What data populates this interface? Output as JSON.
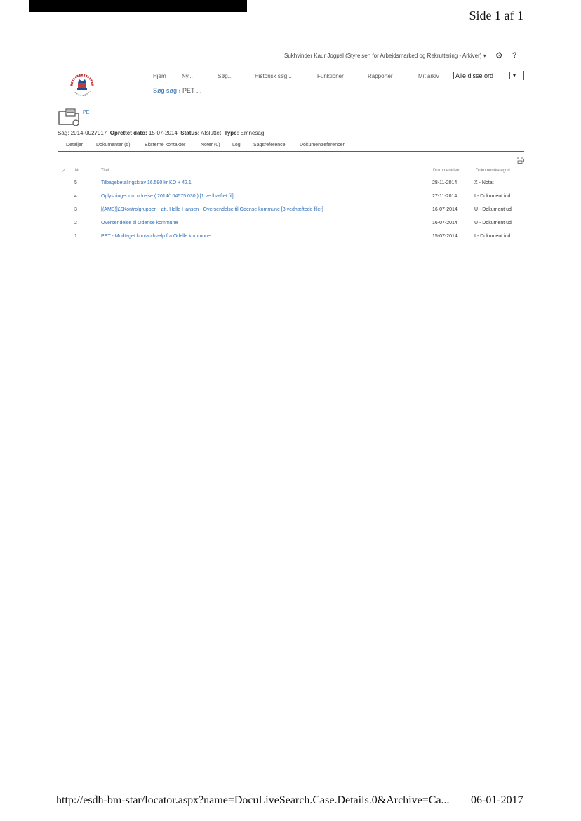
{
  "page_header": {
    "page_number": "Side 1 af 1"
  },
  "topbar": {
    "user": "Sukhvinder Kaur Jogpal (Styrelsen for Arbejdsmarked og Rekruttering - Arkiver)",
    "help": "?"
  },
  "nav": {
    "items": [
      "Hjem",
      "Ny...",
      "Søg...",
      "Historisk søg...",
      "Funktioner",
      "Rapporter",
      "Mit arkiv"
    ],
    "search_mode": "Alle disse ord"
  },
  "breadcrumb": {
    "first": "Søg søg",
    "sep": "›",
    "second": "PET",
    "tail": "..."
  },
  "case": {
    "icon_label": "PE",
    "meta_label_sag": "Sag:",
    "sag": "2014-0027917",
    "meta_label_oprettet": "Oprettet dato:",
    "oprettet": "15-07-2014",
    "meta_label_status": "Status:",
    "status": "Afsluttet",
    "meta_label_type": "Type:",
    "type": "Emnesag"
  },
  "tabs": [
    "Detaljer",
    "Dokumenter (5)",
    "Eksterne kontakter",
    "Noter (0)",
    "Log",
    "Sagsreference",
    "Dokumentreferencer"
  ],
  "table": {
    "headers": {
      "check": "✓",
      "no": "Nr.",
      "title": "Titel",
      "date": "Dokumentdato",
      "cat": "Dokumentkategori"
    },
    "rows": [
      {
        "no": "5",
        "title": "Tilbagebetalingskrav 16.590 kr KO + 42.1",
        "date": "28-11-2014",
        "cat": "X - Notat"
      },
      {
        "no": "4",
        "title": "Oplysninger om udrejse ( 2014/104575 030 ) [1 vedhæftet fil]",
        "date": "27-11-2014",
        "cat": "I - Dokument ind"
      },
      {
        "no": "3",
        "title": "[(AMS)]££Kontrolgruppen - att. Helle Hansen - Oversendelse til Odense kommune [3 vedhæftede filer]",
        "date": "16-07-2014",
        "cat": "U - Dokument ud"
      },
      {
        "no": "2",
        "title": "Oversendelse til Odense kommune",
        "date": "16-07-2014",
        "cat": "U - Dokument ud"
      },
      {
        "no": "1",
        "title": "PET - Modtaget kontanthjælp fra Odelle kommune",
        "date": "15-07-2014",
        "cat": "I - Dokument ind"
      }
    ]
  },
  "footer": {
    "url": "http://esdh-bm-star/locator.aspx?name=DocuLiveSearch.Case.Details.0&Archive=Ca...",
    "date": "06-01-2017"
  },
  "colors": {
    "link": "#2f6db5",
    "rule": "#1f6fa8",
    "logo_red": "#c23a3a"
  }
}
